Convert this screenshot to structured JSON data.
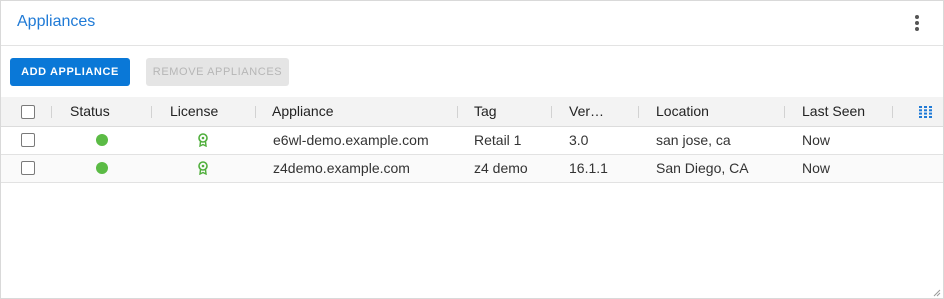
{
  "panel": {
    "title": "Appliances",
    "menu_icon": "kebab-vertical-icon"
  },
  "toolbar": {
    "add_label": "ADD APPLIANCE",
    "remove_label": "REMOVE APPLIANCES"
  },
  "colors": {
    "accent": "#0a78d7",
    "title": "#1f7ad6",
    "status_ok": "#5bbb45",
    "license_ok": "#4fae3b"
  },
  "table": {
    "columns": [
      "Status",
      "License",
      "Appliance",
      "Tag",
      "Ver…",
      "Location",
      "Last Seen"
    ],
    "column_chooser_icon": "columns-icon",
    "rows": [
      {
        "checked": false,
        "status": "online",
        "license": "valid",
        "appliance": "e6wl-demo.example.com",
        "tag": "Retail 1",
        "version": "3.0",
        "location": "san jose, ca",
        "last_seen": "Now"
      },
      {
        "checked": false,
        "status": "online",
        "license": "valid",
        "appliance": "z4demo.example.com",
        "tag": "z4 demo",
        "version": "16.1.1",
        "location": "San Diego, CA",
        "last_seen": "Now"
      }
    ]
  }
}
